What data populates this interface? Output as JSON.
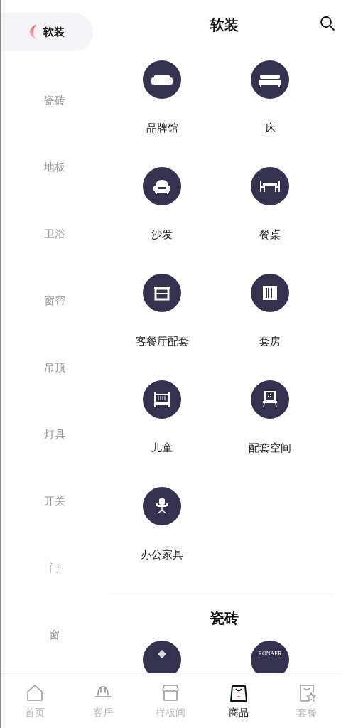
{
  "sidebar": {
    "items": [
      {
        "label": "软装",
        "selected": true
      },
      {
        "label": "瓷砖",
        "selected": false
      },
      {
        "label": "地板",
        "selected": false
      },
      {
        "label": "卫浴",
        "selected": false
      },
      {
        "label": "窗帘",
        "selected": false
      },
      {
        "label": "吊顶",
        "selected": false
      },
      {
        "label": "灯具",
        "selected": false
      },
      {
        "label": "开关",
        "selected": false
      },
      {
        "label": "门",
        "selected": false
      },
      {
        "label": "窗",
        "selected": false
      }
    ]
  },
  "header": {
    "title": "软装"
  },
  "categories": [
    {
      "label": "品牌馆"
    },
    {
      "label": "床"
    },
    {
      "label": "沙发"
    },
    {
      "label": "餐桌"
    },
    {
      "label": "客餐厅配套"
    },
    {
      "label": "套房"
    },
    {
      "label": "儿童"
    },
    {
      "label": "配套空间"
    },
    {
      "label": "办公家具"
    }
  ],
  "next_section": {
    "title": "瓷砖",
    "tiles": [
      {
        "kind": "mark"
      },
      {
        "kind": "wordmark",
        "text": "RONAER"
      }
    ]
  },
  "tab_bar": [
    {
      "label": "首页",
      "selected": false
    },
    {
      "label": "客戶",
      "selected": false
    },
    {
      "label": "样板间",
      "selected": false
    },
    {
      "label": "商品",
      "selected": true
    },
    {
      "label": "套餐",
      "selected": false
    }
  ]
}
